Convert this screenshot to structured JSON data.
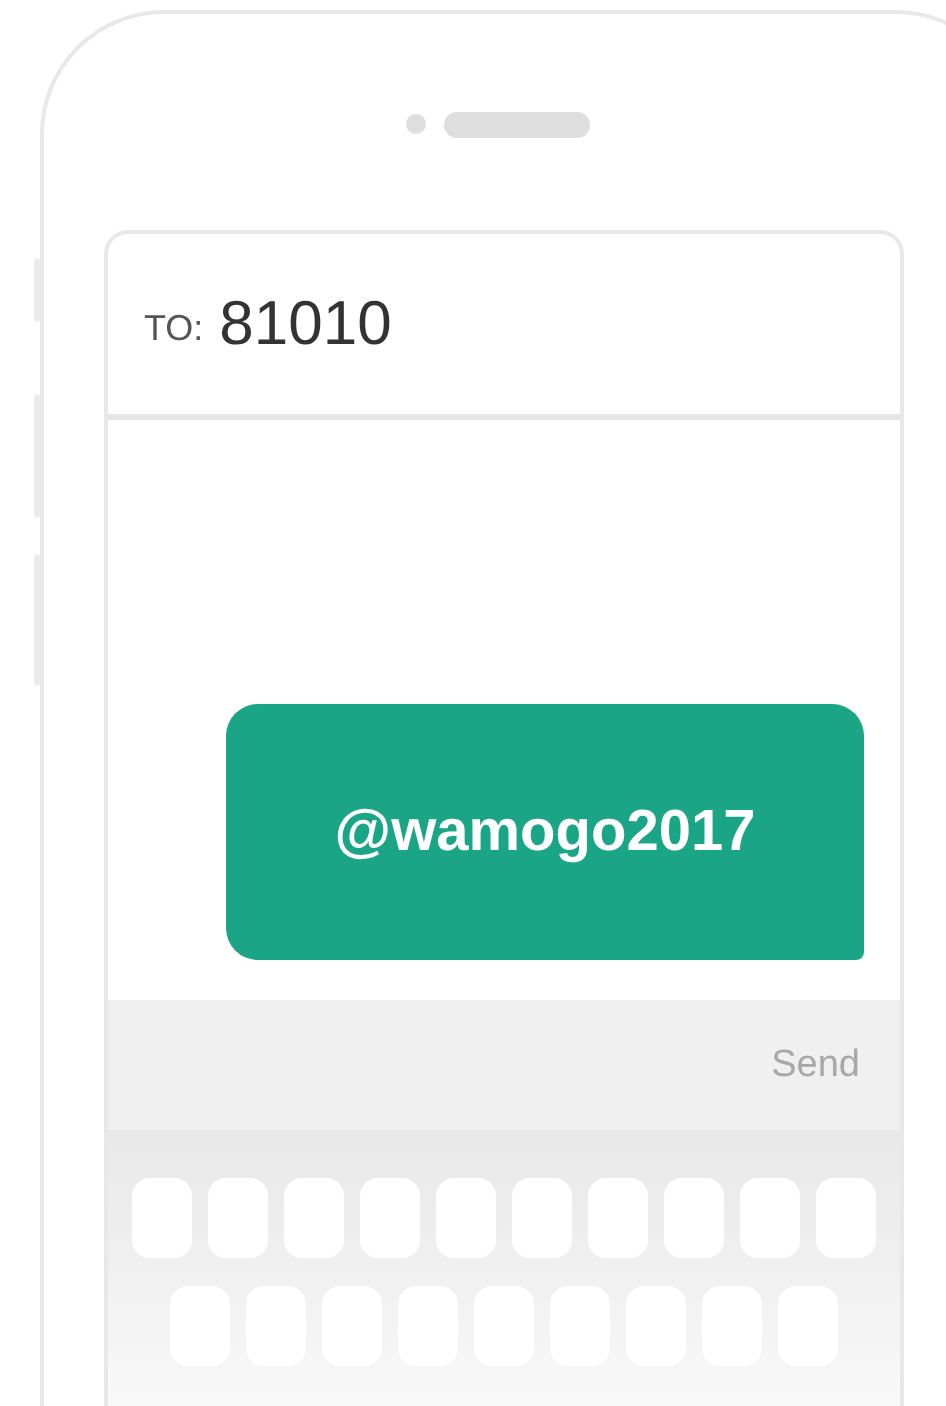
{
  "recipient": {
    "label": "TO:",
    "number": "81010"
  },
  "messages": [
    {
      "text": "@wamogo2017"
    }
  ],
  "send_button": {
    "label": "Send"
  }
}
